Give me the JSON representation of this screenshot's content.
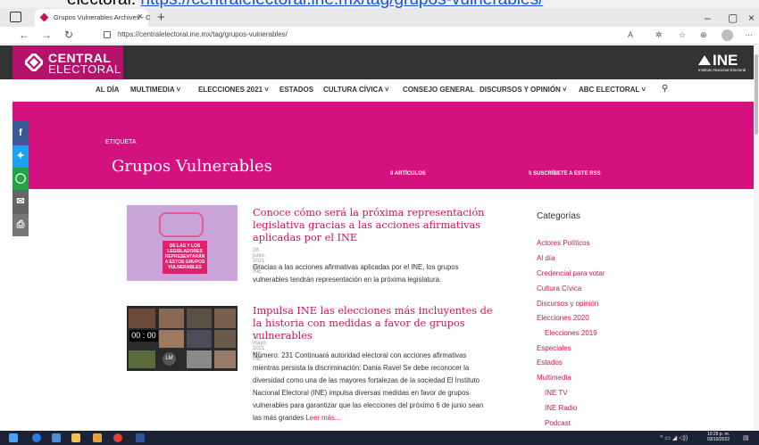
{
  "caption": {
    "prefix": "electoral.",
    "link": "https://centralelectoral.ine.mx/tag/grupos-vulnerables/"
  },
  "browser": {
    "tab_title": "Grupos Vulnerables Archives - C",
    "url": "https://centralelectoral.ine.mx/tag/grupos-vulnerables/"
  },
  "site": {
    "logo_line1": "CENTRAL",
    "logo_line2": "ELECTORAL",
    "ine_word": "INE",
    "ine_sub": "Instituto Nacional Electoral"
  },
  "nav": {
    "items": [
      "AL DÍA",
      "MULTIMEDIA ˅",
      "ELECCIONES 2021 ˅",
      "ESTADOS",
      "CULTURA CÍVICA ˅",
      "CONSEJO GENERAL",
      "DISCURSOS Y OPINIÓN ˅",
      "ABC ELECTORAL ˅"
    ]
  },
  "hero": {
    "tag_label": "ETIQUETA",
    "title": "Grupos Vulnerables",
    "count": "9 ARTÍCULOS",
    "rss": "SUSCRÍBETE A ESTE RSS"
  },
  "articles": [
    {
      "title": "Conoce cómo será la próxima representación legislativa gracias a las acciones afirmativas aplicadas por el INE",
      "meta": "28 junio, 2021 por INE",
      "body": "Gracias a las acciones afirmativas aplicadas por el INE, los grupos vulnerables tendrán representación en la próxima legislatura.",
      "thumb_text": "DE LAS Y LOS LEGISLADORES REPRESENTARÁN A ESTOS GRUPOS VULNERABLES"
    },
    {
      "title": "Impulsa INE las elecciones más incluyentes de la historia con medidas a favor de grupos vulnerables",
      "meta": "14 mayo, 2021 por INE",
      "body": "Número: 231 Continuará autoridad electoral con acciones afirmativas mientras persista la discriminación: Dania Ravel Se debe reconocer la diversidad como una de las mayores fortalezas de la sociedad El Instituto Nacional Electoral (INE) impulsa diversas medidas en favor de grupos vulnerables para garantizar que las elecciones del próximo 6 de junio sean las más grandes",
      "more": "Leer más...",
      "thumb_time": "00 : 00",
      "thumb_initials": "LM"
    }
  ],
  "sidebar": {
    "title": "Categorías",
    "items": [
      {
        "label": "Actores Políticos",
        "indent": false
      },
      {
        "label": "Al día",
        "indent": false
      },
      {
        "label": "Credencial para votar",
        "indent": false
      },
      {
        "label": "Cultura Cívica",
        "indent": false
      },
      {
        "label": "Discursos y opinión",
        "indent": false
      },
      {
        "label": "Elecciones 2020",
        "indent": false
      },
      {
        "label": "Elecciones 2019",
        "indent": true
      },
      {
        "label": "Especiales",
        "indent": false
      },
      {
        "label": "Estados",
        "indent": false
      },
      {
        "label": "Multimedia",
        "indent": false
      },
      {
        "label": "INE TV",
        "indent": true
      },
      {
        "label": "INE Radio",
        "indent": true
      },
      {
        "label": "Podcast",
        "indent": true
      }
    ]
  },
  "taskbar": {
    "time": "10:29 p. m.",
    "date": "03/10/2022"
  },
  "colors": {
    "brand": "#d4127f",
    "link": "#c2185b"
  }
}
